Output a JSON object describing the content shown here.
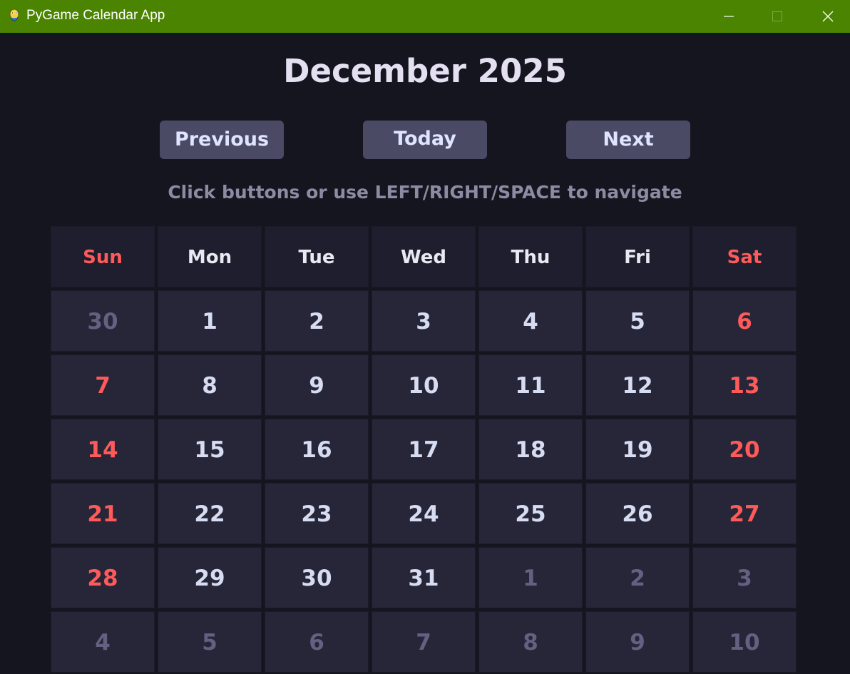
{
  "window": {
    "title": "PyGame Calendar App",
    "titlebar_color": "#4a8400",
    "icon": "pygame-snake-icon"
  },
  "header": {
    "month_title": "December 2025"
  },
  "nav": {
    "previous_label": "Previous",
    "today_label": "Today",
    "next_label": "Next"
  },
  "instructions": "Click buttons or use LEFT/RIGHT/SPACE to navigate",
  "calendar": {
    "weekdays": [
      "Sun",
      "Mon",
      "Tue",
      "Wed",
      "Thu",
      "Fri",
      "Sat"
    ],
    "weeks": [
      [
        "30",
        "1",
        "2",
        "3",
        "4",
        "5",
        "6"
      ],
      [
        "7",
        "8",
        "9",
        "10",
        "11",
        "12",
        "13"
      ],
      [
        "14",
        "15",
        "16",
        "17",
        "18",
        "19",
        "20"
      ],
      [
        "21",
        "22",
        "23",
        "24",
        "25",
        "26",
        "27"
      ],
      [
        "28",
        "29",
        "30",
        "31",
        "1",
        "2",
        "3"
      ],
      [
        "4",
        "5",
        "6",
        "7",
        "8",
        "9",
        "10"
      ]
    ],
    "other_month_flags": [
      [
        true,
        false,
        false,
        false,
        false,
        false,
        false
      ],
      [
        false,
        false,
        false,
        false,
        false,
        false,
        false
      ],
      [
        false,
        false,
        false,
        false,
        false,
        false,
        false
      ],
      [
        false,
        false,
        false,
        false,
        false,
        false,
        false
      ],
      [
        false,
        false,
        false,
        false,
        true,
        true,
        true
      ],
      [
        true,
        true,
        true,
        true,
        true,
        true,
        true
      ]
    ]
  },
  "colors": {
    "background": "#15151f",
    "cell": "#262638",
    "header_cell": "#1e1e2e",
    "button": "#4a4a65",
    "weekend_text": "#ff5a5a",
    "day_text": "#d7dcf2",
    "other_month_text": "#636182",
    "instructions_text": "#8c8ba3"
  }
}
